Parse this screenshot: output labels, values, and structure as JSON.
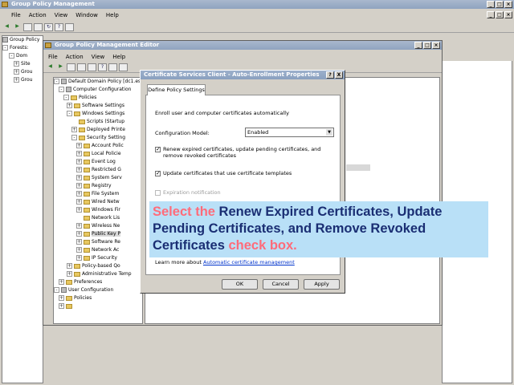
{
  "gpm": {
    "title": "Group Policy Management",
    "menu": [
      "File",
      "Action",
      "View",
      "Window",
      "Help"
    ],
    "tree": [
      "Group Policy",
      "Forests:",
      "Dom",
      "Site",
      "Grou",
      "Grou"
    ]
  },
  "gpme": {
    "title": "Group Policy Management Editor",
    "menu": [
      "File",
      "Action",
      "View",
      "Help"
    ],
    "tree": [
      {
        "label": "Default Domain Policy [dc1.es-n...",
        "exp": "-"
      },
      {
        "label": "Computer Configuration",
        "exp": "-"
      },
      {
        "label": "Policies",
        "exp": "-"
      },
      {
        "label": "Software Settings",
        "exp": "+"
      },
      {
        "label": "Windows Settings",
        "exp": "-"
      },
      {
        "label": "Scripts (Startup",
        "exp": ""
      },
      {
        "label": "Deployed Printe",
        "exp": "+"
      },
      {
        "label": "Security Setting",
        "exp": "-"
      },
      {
        "label": "Account Polic",
        "exp": "+"
      },
      {
        "label": "Local Policie",
        "exp": "+"
      },
      {
        "label": "Event Log",
        "exp": "+"
      },
      {
        "label": "Restricted G",
        "exp": "+"
      },
      {
        "label": "System Serv",
        "exp": "+"
      },
      {
        "label": "Registry",
        "exp": "+"
      },
      {
        "label": "File System",
        "exp": "+"
      },
      {
        "label": "Wired Netw",
        "exp": "+"
      },
      {
        "label": "Windows Fir",
        "exp": "+"
      },
      {
        "label": "Network Lis",
        "exp": ""
      },
      {
        "label": "Wireless Ne",
        "exp": "+"
      },
      {
        "label": "Public Key P",
        "exp": "+"
      },
      {
        "label": "Software Re",
        "exp": "+"
      },
      {
        "label": "Network Ac",
        "exp": "+"
      },
      {
        "label": "IP Security",
        "exp": "+"
      },
      {
        "label": "Policy-based Qo",
        "exp": "+"
      },
      {
        "label": "Administrative Temp",
        "exp": "+"
      },
      {
        "label": "Preferences",
        "exp": "+"
      },
      {
        "label": "User Configuration",
        "exp": "-"
      },
      {
        "label": "Policies",
        "exp": "+"
      },
      {
        "label": "",
        "exp": "+"
      }
    ]
  },
  "dialog": {
    "title": "Certificate Services Client - Auto-Enrollment Properties",
    "help_btn": "?",
    "close_btn": "X",
    "tab": "Define Policy Settings",
    "intro": "Enroll user and computer certificates automatically",
    "config_label": "Configuration Model:",
    "config_value": "Enabled",
    "cb1_label": "Renew expired certificates, update pending certificates, and remove revoked certificates",
    "cb1_checked": true,
    "cb2_label": "Update certificates that use certificate templates",
    "cb2_checked": true,
    "cb3_label": "Expiration notification",
    "link_prefix": "Learn more about",
    "link_text": "Automatic certificate management",
    "ok": "OK",
    "cancel": "Cancel",
    "apply": "Apply"
  },
  "callout": {
    "part1": "Select the",
    "part2": "Renew Expired Certificates, Update Pending Certificates, and Remove Revoked Certificates",
    "part3": "check box."
  }
}
